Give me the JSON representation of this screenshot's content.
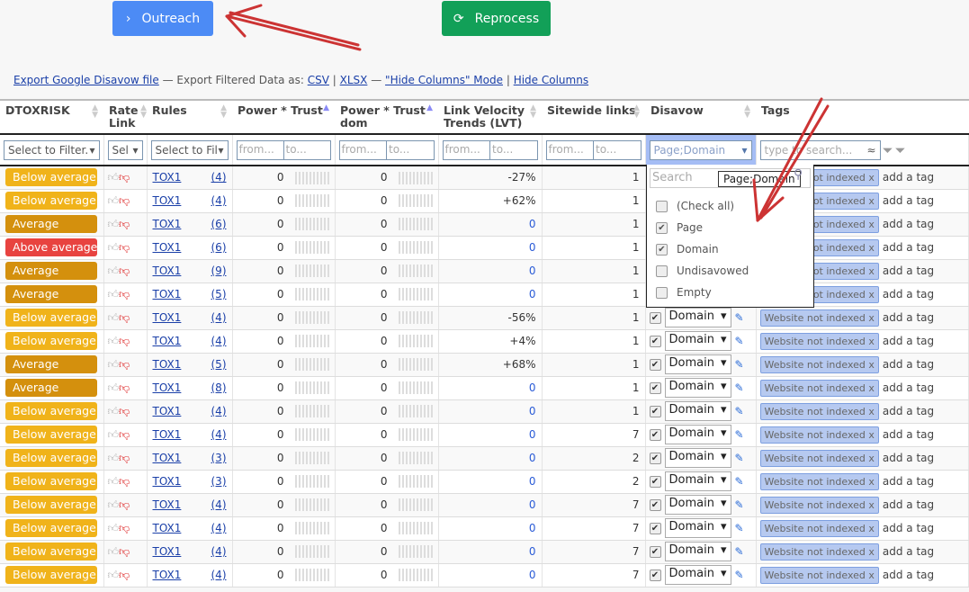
{
  "toolbar": {
    "outreach": "Outreach",
    "reprocess": "Reprocess"
  },
  "links": {
    "export_disavow": "Export Google Disavow file",
    "export_text": "— Export Filtered Data as:",
    "csv": "CSV",
    "xlsx": "XLSX",
    "dash": "—",
    "hide_mode": "\"Hide Columns\" Mode",
    "hide_columns": "Hide Columns",
    "sep": "|"
  },
  "columns": [
    "DTOXRISK",
    "Rate Link",
    "Rules",
    "Power * Trust",
    "Power * Trust dom",
    "Link Velocity Trends (LVT)",
    "Sitewide links",
    "Disavow",
    "Tags"
  ],
  "filters": {
    "dtox": "Select to Filter.",
    "rate": "Sel",
    "rules": "Select to Fil",
    "from": "from...",
    "to": "to...",
    "disavow": "Page;Domain",
    "tags_placeholder": "type to search..."
  },
  "dropdown": {
    "search": "Search",
    "tooltip": "Page;Domain",
    "options": [
      {
        "label": "(Check all)",
        "checked": false
      },
      {
        "label": "Page",
        "checked": true
      },
      {
        "label": "Domain",
        "checked": true
      },
      {
        "label": "Undisavowed",
        "checked": false
      },
      {
        "label": "Empty",
        "checked": false
      }
    ]
  },
  "colors": {
    "Below average": "#f0b31a",
    "Average": "#d4900d",
    "Above average": "#e84340"
  },
  "row_defaults": {
    "rule": "TOX1",
    "power": "0",
    "trust_dom": "0",
    "disavow": "Domain",
    "tag": "Website not indexed",
    "tag_remove": "x",
    "add_tag": "add a tag"
  },
  "rows": [
    {
      "risk": "Below average",
      "count": "(4)",
      "lvt": "-27%",
      "sitewide": "1"
    },
    {
      "risk": "Below average",
      "count": "(4)",
      "lvt": "+62%",
      "sitewide": "1"
    },
    {
      "risk": "Average",
      "count": "(6)",
      "lvt": "0",
      "sitewide": "1"
    },
    {
      "risk": "Above average",
      "count": "(6)",
      "lvt": "0",
      "sitewide": "1"
    },
    {
      "risk": "Average",
      "count": "(9)",
      "lvt": "0",
      "sitewide": "1"
    },
    {
      "risk": "Average",
      "count": "(5)",
      "lvt": "0",
      "sitewide": "1"
    },
    {
      "risk": "Below average",
      "count": "(4)",
      "lvt": "-56%",
      "sitewide": "1"
    },
    {
      "risk": "Below average",
      "count": "(4)",
      "lvt": "+4%",
      "sitewide": "1"
    },
    {
      "risk": "Average",
      "count": "(5)",
      "lvt": "+68%",
      "sitewide": "1"
    },
    {
      "risk": "Average",
      "count": "(8)",
      "lvt": "0",
      "sitewide": "1"
    },
    {
      "risk": "Below average",
      "count": "(4)",
      "lvt": "0",
      "sitewide": "1"
    },
    {
      "risk": "Below average",
      "count": "(4)",
      "lvt": "0",
      "sitewide": "7"
    },
    {
      "risk": "Below average",
      "count": "(3)",
      "lvt": "0",
      "sitewide": "2"
    },
    {
      "risk": "Below average",
      "count": "(3)",
      "lvt": "0",
      "sitewide": "2"
    },
    {
      "risk": "Below average",
      "count": "(4)",
      "lvt": "0",
      "sitewide": "7"
    },
    {
      "risk": "Below average",
      "count": "(4)",
      "lvt": "0",
      "sitewide": "7"
    },
    {
      "risk": "Below average",
      "count": "(4)",
      "lvt": "0",
      "sitewide": "7"
    },
    {
      "risk": "Below average",
      "count": "(4)",
      "lvt": "0",
      "sitewide": "7"
    }
  ]
}
